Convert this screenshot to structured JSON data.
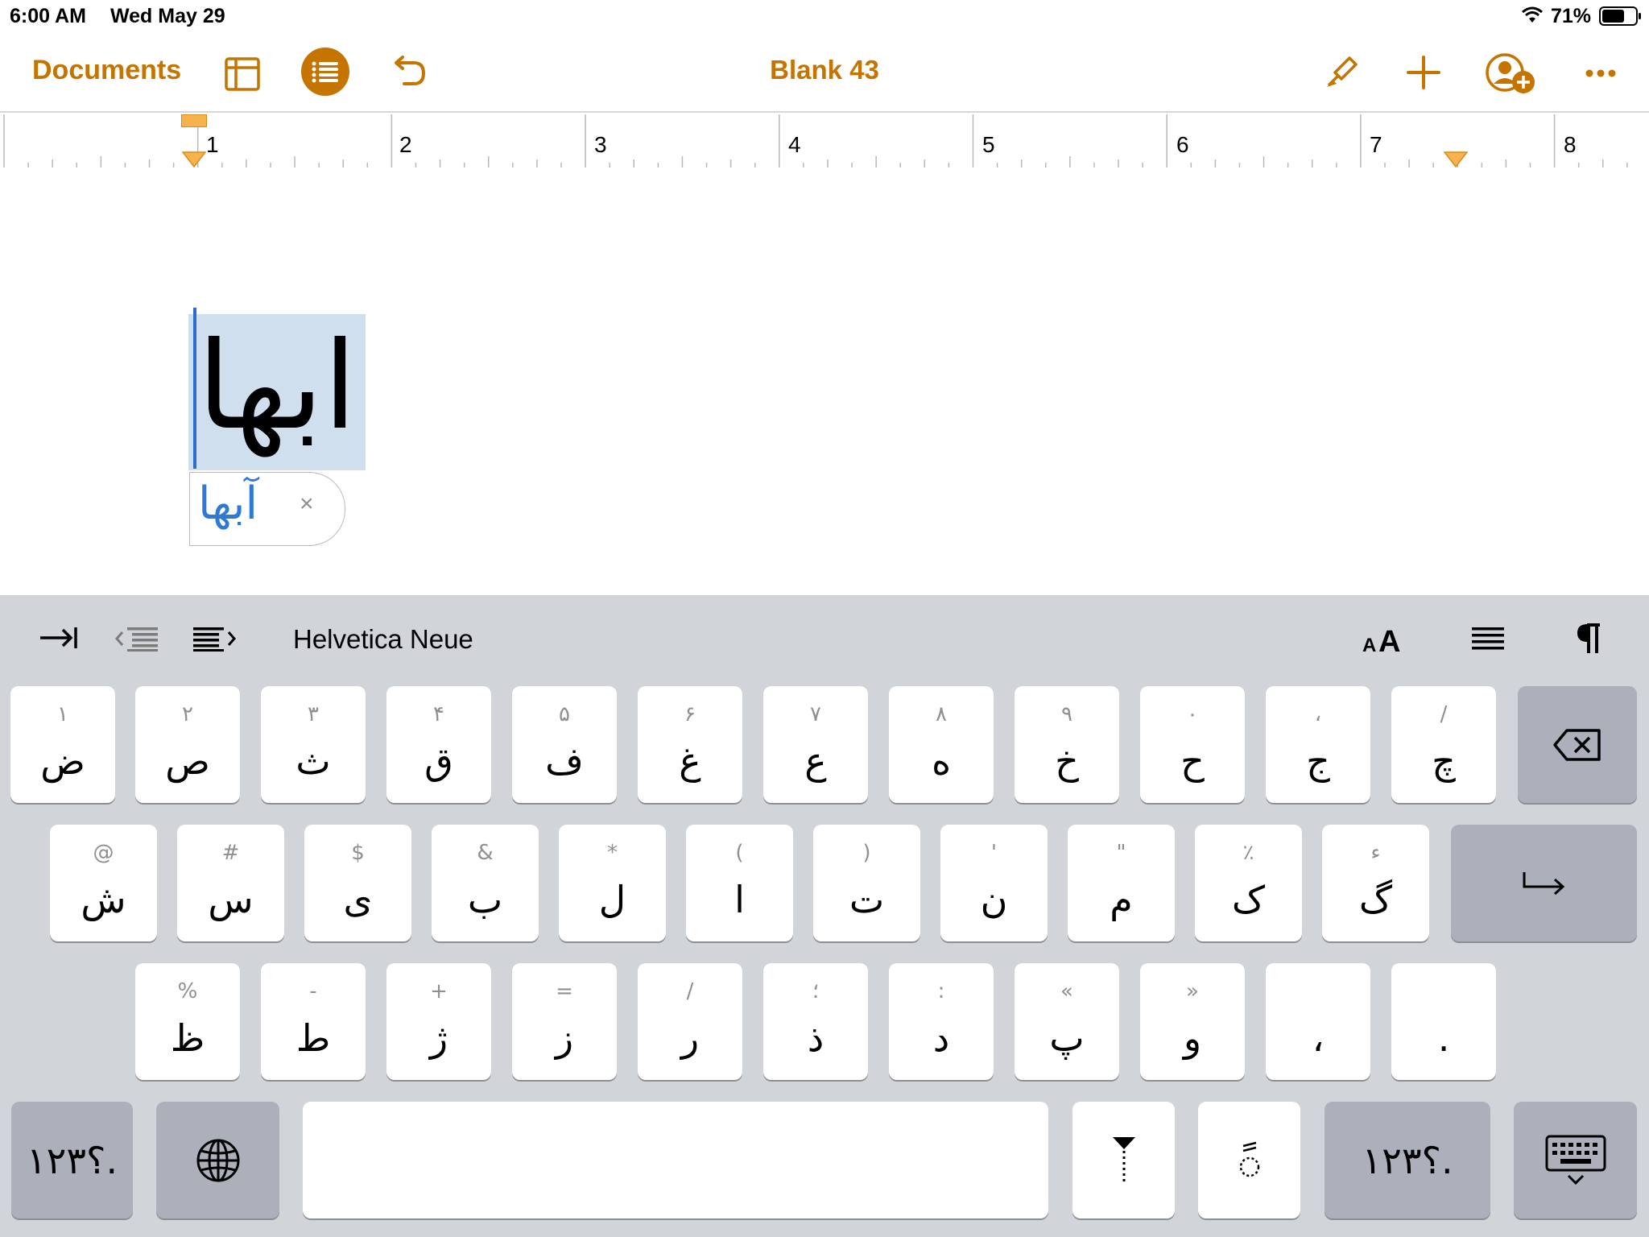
{
  "status_bar": {
    "time": "6:00 AM",
    "date": "Wed May 29",
    "battery_percent": "71%",
    "battery_level": 0.71
  },
  "toolbar": {
    "documents_label": "Documents",
    "title": "Blank 43",
    "accent_color": "#c57400",
    "icons": [
      "view-options-icon",
      "list-icon",
      "undo-icon",
      "format-brush-icon",
      "plus-icon",
      "collaborate-icon",
      "more-icon"
    ]
  },
  "ruler": {
    "numbers": [
      "1",
      "2",
      "3",
      "4",
      "5",
      "6",
      "7",
      "8"
    ]
  },
  "document": {
    "text": "ابها",
    "suggestion": "آبها",
    "suggestion_close": "×"
  },
  "keyboard": {
    "font_name": "Helvetica Neue",
    "row1": [
      {
        "pri": "ض",
        "sec": "۱"
      },
      {
        "pri": "ص",
        "sec": "۲"
      },
      {
        "pri": "ث",
        "sec": "۳"
      },
      {
        "pri": "ق",
        "sec": "۴"
      },
      {
        "pri": "ف",
        "sec": "۵"
      },
      {
        "pri": "غ",
        "sec": "۶"
      },
      {
        "pri": "ع",
        "sec": "۷"
      },
      {
        "pri": "ه",
        "sec": "۸"
      },
      {
        "pri": "خ",
        "sec": "۹"
      },
      {
        "pri": "ح",
        "sec": "۰"
      },
      {
        "pri": "ج",
        "sec": "،"
      },
      {
        "pri": "چ",
        "sec": "/"
      }
    ],
    "row2": [
      {
        "pri": "ش",
        "sec": "@"
      },
      {
        "pri": "س",
        "sec": "#"
      },
      {
        "pri": "ی",
        "sec": "$"
      },
      {
        "pri": "ب",
        "sec": "&"
      },
      {
        "pri": "ل",
        "sec": "*"
      },
      {
        "pri": "ا",
        "sec": "("
      },
      {
        "pri": "ت",
        "sec": ")"
      },
      {
        "pri": "ن",
        "sec": "'"
      },
      {
        "pri": "م",
        "sec": "\""
      },
      {
        "pri": "ک",
        "sec": "٪"
      },
      {
        "pri": "گ",
        "sec": "ء"
      }
    ],
    "row3": [
      {
        "pri": "ظ",
        "sec": "%"
      },
      {
        "pri": "ط",
        "sec": "-"
      },
      {
        "pri": "ژ",
        "sec": "+"
      },
      {
        "pri": "ز",
        "sec": "="
      },
      {
        "pri": "ر",
        "sec": "/"
      },
      {
        "pri": "ذ",
        "sec": "؛"
      },
      {
        "pri": "د",
        "sec": ":"
      },
      {
        "pri": "پ",
        "sec": "«"
      },
      {
        "pri": "و",
        "sec": "»"
      },
      {
        "pri": "،",
        "sec": ""
      },
      {
        "pri": ".",
        "sec": ""
      }
    ],
    "numbers_label": "۱۲۳؟.",
    "key_colors": {
      "light": "#ffffff",
      "dark": "#abb0ba",
      "background": "#d1d4d9"
    }
  }
}
